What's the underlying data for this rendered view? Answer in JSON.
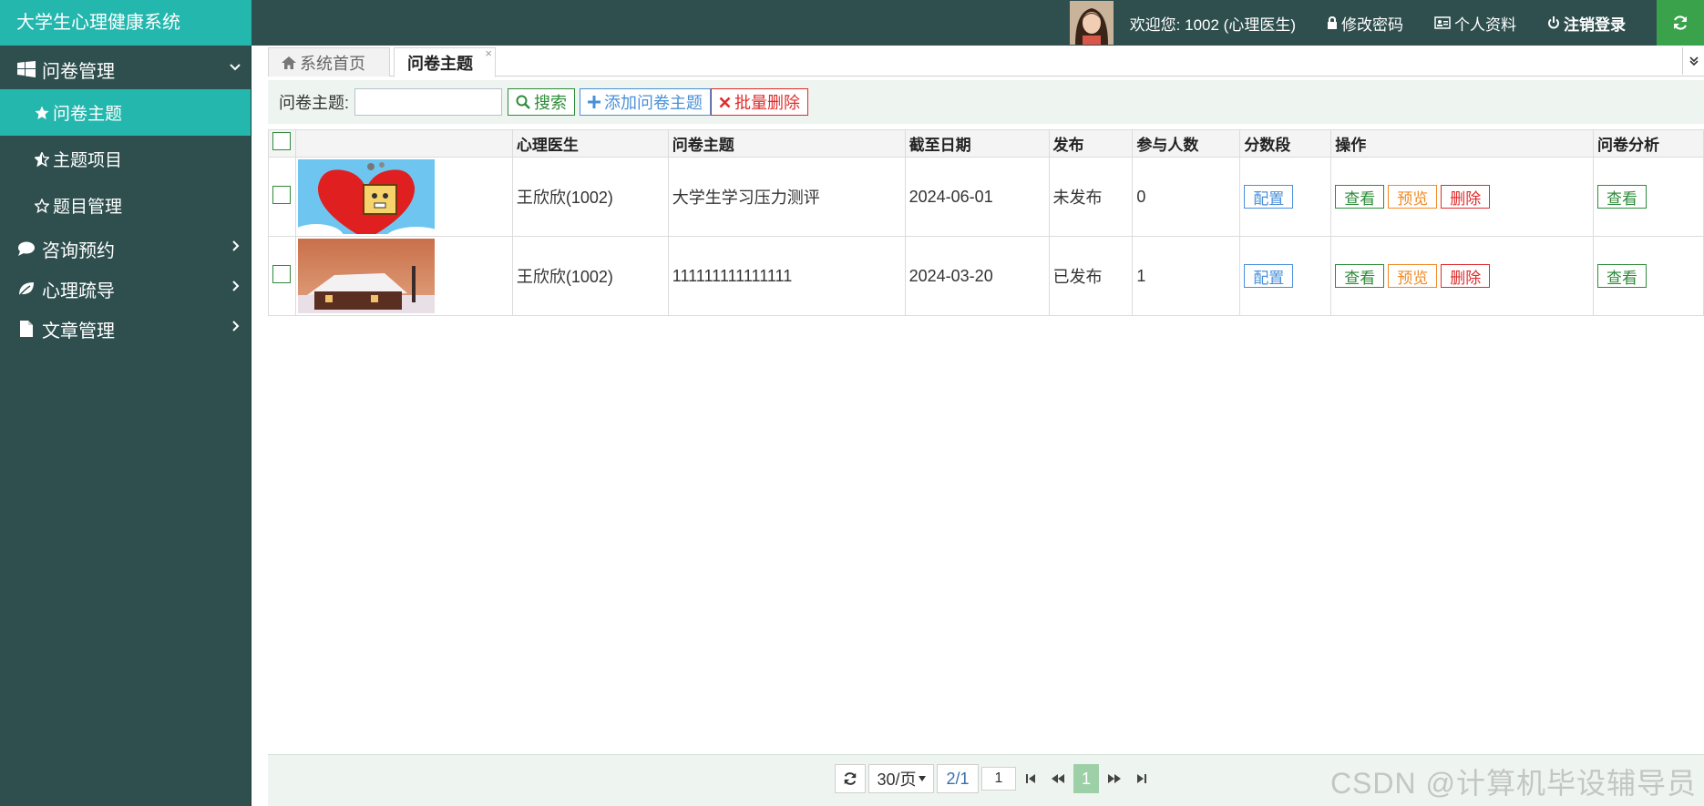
{
  "app": {
    "title": "大学生心理健康系统",
    "welcome": "欢迎您: 1002 (心理医生)",
    "change_password": "修改密码",
    "profile": "个人资料",
    "logout": "注销登录"
  },
  "colors": {
    "sidebar_bg": "#2f4f4f",
    "accent": "#23b7ae",
    "green": "#2e8b3a",
    "blue": "#4a90d9",
    "orange": "#f08a24",
    "red": "#e02b2b"
  },
  "sidebar": {
    "groups": [
      {
        "label": "问卷管理",
        "icon": "windows-icon",
        "expanded": true,
        "items": [
          {
            "label": "问卷主题",
            "icon": "star-filled-icon",
            "active": true
          },
          {
            "label": "主题项目",
            "icon": "star-half-icon",
            "active": false
          },
          {
            "label": "题目管理",
            "icon": "star-outline-icon",
            "active": false
          }
        ]
      },
      {
        "label": "咨询预约",
        "icon": "comment-icon",
        "expanded": false
      },
      {
        "label": "心理疏导",
        "icon": "leaf-icon",
        "expanded": false
      },
      {
        "label": "文章管理",
        "icon": "file-icon",
        "expanded": false
      }
    ]
  },
  "tabs": {
    "home": "系统首页",
    "active": "问卷主题",
    "close": "×"
  },
  "toolbar": {
    "search_label": "问卷主题:",
    "search_value": "",
    "search_button": "搜索",
    "add_button": "添加问卷主题",
    "batch_delete_button": "批量删除"
  },
  "table": {
    "columns": [
      "",
      "",
      "心理医生",
      "问卷主题",
      "截至日期",
      "发布",
      "参与人数",
      "分数段",
      "操作",
      "问卷分析"
    ],
    "rows": [
      {
        "image": "heart-cartoon-image",
        "doctor": "王欣欣(1002)",
        "topic": "大学生学习压力测评",
        "deadline": "2024-06-01",
        "published": "未发布",
        "participants": "0",
        "score_button": "配置",
        "view_button": "查看",
        "preview_button": "预览",
        "delete_button": "删除",
        "analysis_button": "查看"
      },
      {
        "image": "snow-cabin-image",
        "doctor": "王欣欣(1002)",
        "topic": "111111111111111",
        "deadline": "2024-03-20",
        "published": "已发布",
        "participants": "1",
        "score_button": "配置",
        "view_button": "查看",
        "preview_button": "预览",
        "delete_button": "删除",
        "analysis_button": "查看"
      }
    ]
  },
  "pager": {
    "page_size": "30/页",
    "page_info": "2/1",
    "page_input": "1",
    "current_page": "1"
  },
  "watermark": "CSDN @计算机毕设辅导员"
}
